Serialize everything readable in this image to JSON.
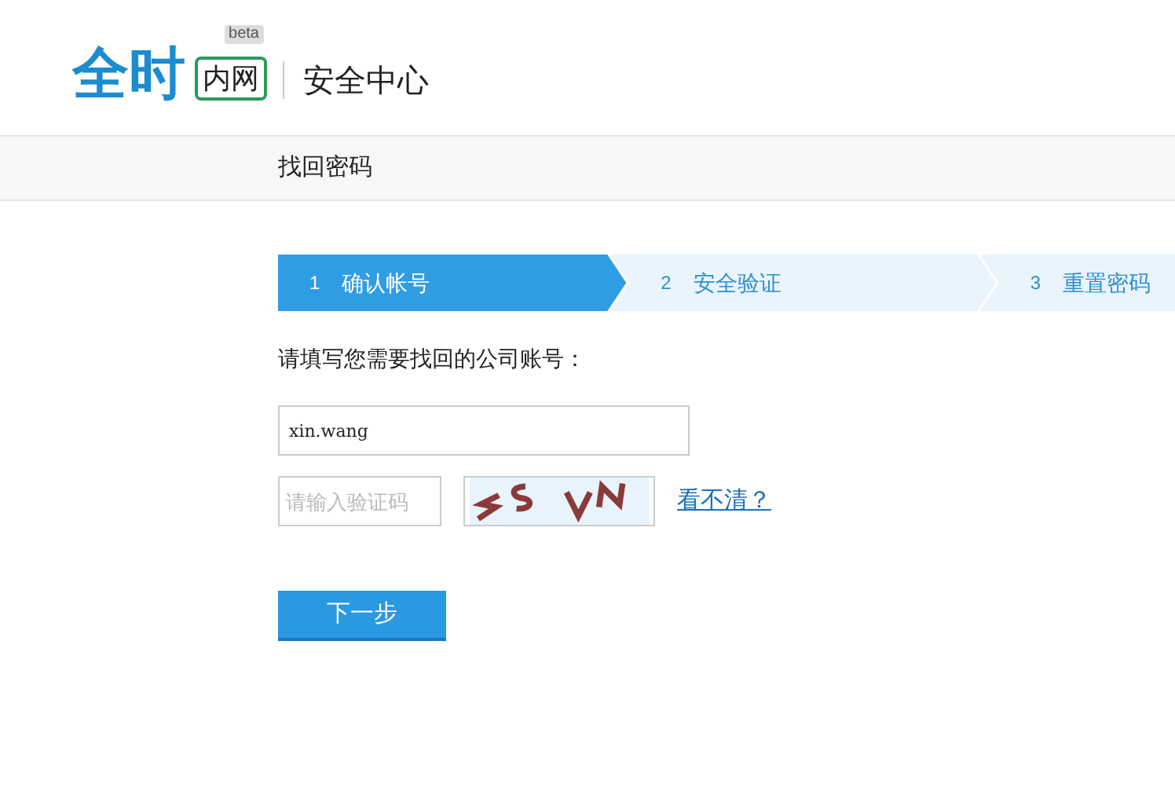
{
  "header": {
    "logo": "全时",
    "logo_badge": "内网",
    "beta": "beta",
    "title": "安全中心"
  },
  "page_title": "找回密码",
  "steps": [
    {
      "number": "1",
      "label": "确认帐号",
      "selected": true
    },
    {
      "number": "2",
      "label": "安全验证",
      "selected": false
    },
    {
      "number": "3",
      "label": "重置密码",
      "selected": false
    }
  ],
  "form": {
    "prompt": "请填写您需要找回的公司账号：",
    "account": {
      "value": "xin.wang"
    },
    "captcha": {
      "placeholder": "请输入验证码"
    },
    "refresh_link": "看不清？",
    "submit": "下一步"
  }
}
